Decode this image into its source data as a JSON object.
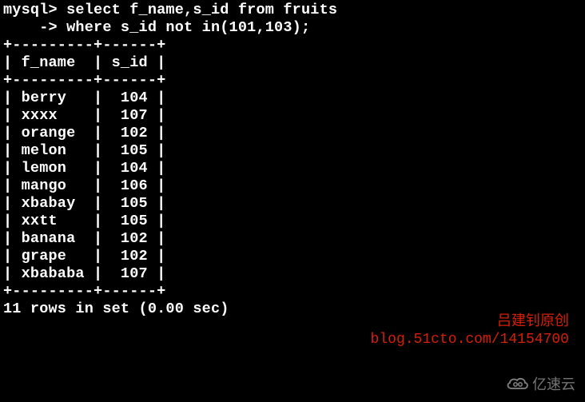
{
  "prompt": "mysql>",
  "continuation": "    ->",
  "query_line1": " select f_name,s_id from fruits",
  "query_line2": " where s_id not in(101,103);",
  "table": {
    "border_top": "+---------+------+",
    "header_row": "| f_name  | s_id |",
    "border_mid": "+---------+------+",
    "rows": [
      "| berry   |  104 |",
      "| xxxx    |  107 |",
      "| orange  |  102 |",
      "| melon   |  105 |",
      "| lemon   |  104 |",
      "| mango   |  106 |",
      "| xbabay  |  105 |",
      "| xxtt    |  105 |",
      "| banana  |  102 |",
      "| grape   |  102 |",
      "| xbababa |  107 |"
    ],
    "border_bot": "+---------+------+"
  },
  "chart_data": {
    "type": "table",
    "columns": [
      "f_name",
      "s_id"
    ],
    "rows": [
      {
        "f_name": "berry",
        "s_id": 104
      },
      {
        "f_name": "xxxx",
        "s_id": 107
      },
      {
        "f_name": "orange",
        "s_id": 102
      },
      {
        "f_name": "melon",
        "s_id": 105
      },
      {
        "f_name": "lemon",
        "s_id": 104
      },
      {
        "f_name": "mango",
        "s_id": 106
      },
      {
        "f_name": "xbabay",
        "s_id": 105
      },
      {
        "f_name": "xxtt",
        "s_id": 105
      },
      {
        "f_name": "banana",
        "s_id": 102
      },
      {
        "f_name": "grape",
        "s_id": 102
      },
      {
        "f_name": "xbababa",
        "s_id": 107
      }
    ]
  },
  "status": "11 rows in set (0.00 sec)",
  "watermark_author": "吕建钊原创",
  "watermark_blog": "blog.51cto.com/14154700",
  "watermark_brand": "亿速云"
}
